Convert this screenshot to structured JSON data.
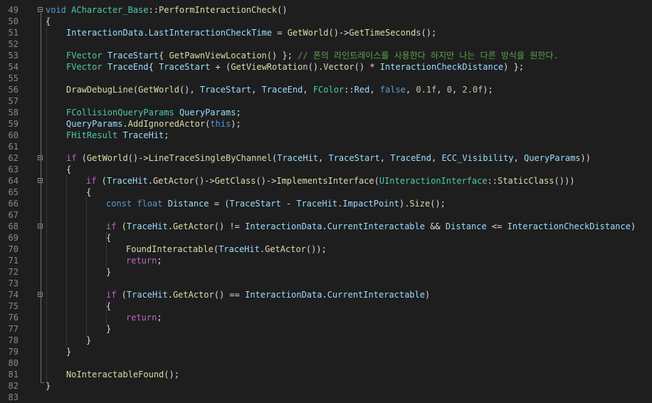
{
  "editor": {
    "lines": [
      {
        "num": "49",
        "fold": true,
        "indent": 0,
        "tokens": [
          {
            "t": "void",
            "c": "kw"
          },
          {
            "t": " ",
            "c": "pl"
          },
          {
            "t": "ACharacter_Base",
            "c": "ty"
          },
          {
            "t": "::",
            "c": "pl"
          },
          {
            "t": "PerformInteractionCheck",
            "c": "fn"
          },
          {
            "t": "()",
            "c": "pl"
          }
        ]
      },
      {
        "num": "50",
        "indent": 0,
        "tokens": [
          {
            "t": "{",
            "c": "pl"
          }
        ]
      },
      {
        "num": "51",
        "indent": 1,
        "tokens": [
          {
            "t": "InteractionData",
            "c": "var"
          },
          {
            "t": ".",
            "c": "pl"
          },
          {
            "t": "LastInteractionCheckTime",
            "c": "var"
          },
          {
            "t": " = ",
            "c": "pl"
          },
          {
            "t": "GetWorld",
            "c": "fn"
          },
          {
            "t": "()->",
            "c": "pl"
          },
          {
            "t": "GetTimeSeconds",
            "c": "fn"
          },
          {
            "t": "();",
            "c": "pl"
          }
        ]
      },
      {
        "num": "52",
        "indent": 1,
        "tokens": []
      },
      {
        "num": "53",
        "indent": 1,
        "tokens": [
          {
            "t": "FVector",
            "c": "ty"
          },
          {
            "t": " ",
            "c": "pl"
          },
          {
            "t": "TraceStart",
            "c": "var"
          },
          {
            "t": "{ ",
            "c": "pl"
          },
          {
            "t": "GetPawnViewLocation",
            "c": "fn"
          },
          {
            "t": "() }; ",
            "c": "pl"
          },
          {
            "t": "// 폰의 라인트레이스를 사용한다 하지만 나는 다른 방식을 원한다.",
            "c": "cm"
          }
        ]
      },
      {
        "num": "54",
        "indent": 1,
        "tokens": [
          {
            "t": "FVector",
            "c": "ty"
          },
          {
            "t": " ",
            "c": "pl"
          },
          {
            "t": "TraceEnd",
            "c": "var"
          },
          {
            "t": "{ ",
            "c": "pl"
          },
          {
            "t": "TraceStart",
            "c": "var"
          },
          {
            "t": " + (",
            "c": "pl"
          },
          {
            "t": "GetViewRotation",
            "c": "fn"
          },
          {
            "t": "().",
            "c": "pl"
          },
          {
            "t": "Vector",
            "c": "fn"
          },
          {
            "t": "() * ",
            "c": "pl"
          },
          {
            "t": "InteractionCheckDistance",
            "c": "var"
          },
          {
            "t": ") };",
            "c": "pl"
          }
        ]
      },
      {
        "num": "55",
        "indent": 1,
        "tokens": []
      },
      {
        "num": "56",
        "indent": 1,
        "tokens": [
          {
            "t": "DrawDebugLine",
            "c": "fn"
          },
          {
            "t": "(",
            "c": "pl"
          },
          {
            "t": "GetWorld",
            "c": "fn"
          },
          {
            "t": "(), ",
            "c": "pl"
          },
          {
            "t": "TraceStart",
            "c": "var"
          },
          {
            "t": ", ",
            "c": "pl"
          },
          {
            "t": "TraceEnd",
            "c": "var"
          },
          {
            "t": ", ",
            "c": "pl"
          },
          {
            "t": "FColor",
            "c": "ty"
          },
          {
            "t": "::",
            "c": "pl"
          },
          {
            "t": "Red",
            "c": "var"
          },
          {
            "t": ", ",
            "c": "pl"
          },
          {
            "t": "false",
            "c": "kw"
          },
          {
            "t": ", ",
            "c": "pl"
          },
          {
            "t": "0.1f",
            "c": "num"
          },
          {
            "t": ", ",
            "c": "pl"
          },
          {
            "t": "0",
            "c": "num"
          },
          {
            "t": ", ",
            "c": "pl"
          },
          {
            "t": "2.0f",
            "c": "num"
          },
          {
            "t": ");",
            "c": "pl"
          }
        ]
      },
      {
        "num": "57",
        "indent": 1,
        "tokens": []
      },
      {
        "num": "58",
        "indent": 1,
        "tokens": [
          {
            "t": "FCollisionQueryParams",
            "c": "ty"
          },
          {
            "t": " ",
            "c": "pl"
          },
          {
            "t": "QueryParams",
            "c": "var"
          },
          {
            "t": ";",
            "c": "pl"
          }
        ]
      },
      {
        "num": "59",
        "indent": 1,
        "tokens": [
          {
            "t": "QueryParams",
            "c": "var"
          },
          {
            "t": ".",
            "c": "pl"
          },
          {
            "t": "AddIgnoredActor",
            "c": "fn"
          },
          {
            "t": "(",
            "c": "pl"
          },
          {
            "t": "this",
            "c": "kw"
          },
          {
            "t": ");",
            "c": "pl"
          }
        ]
      },
      {
        "num": "60",
        "indent": 1,
        "tokens": [
          {
            "t": "FHitResult",
            "c": "ty"
          },
          {
            "t": " ",
            "c": "pl"
          },
          {
            "t": "TraceHit",
            "c": "var"
          },
          {
            "t": ";",
            "c": "pl"
          }
        ]
      },
      {
        "num": "61",
        "indent": 1,
        "tokens": []
      },
      {
        "num": "62",
        "fold": true,
        "indent": 1,
        "tokens": [
          {
            "t": "if",
            "c": "mac"
          },
          {
            "t": " (",
            "c": "pl"
          },
          {
            "t": "GetWorld",
            "c": "fn"
          },
          {
            "t": "()->",
            "c": "pl"
          },
          {
            "t": "LineTraceSingleByChannel",
            "c": "fn"
          },
          {
            "t": "(",
            "c": "pl"
          },
          {
            "t": "TraceHit",
            "c": "var"
          },
          {
            "t": ", ",
            "c": "pl"
          },
          {
            "t": "TraceStart",
            "c": "var"
          },
          {
            "t": ", ",
            "c": "pl"
          },
          {
            "t": "TraceEnd",
            "c": "var"
          },
          {
            "t": ", ",
            "c": "pl"
          },
          {
            "t": "ECC_Visibility",
            "c": "var"
          },
          {
            "t": ", ",
            "c": "pl"
          },
          {
            "t": "QueryParams",
            "c": "var"
          },
          {
            "t": "))",
            "c": "pl"
          }
        ]
      },
      {
        "num": "63",
        "indent": 1,
        "tokens": [
          {
            "t": "{",
            "c": "pl"
          }
        ]
      },
      {
        "num": "64",
        "fold": true,
        "indent": 2,
        "tokens": [
          {
            "t": "if",
            "c": "mac"
          },
          {
            "t": " (",
            "c": "pl"
          },
          {
            "t": "TraceHit",
            "c": "var"
          },
          {
            "t": ".",
            "c": "pl"
          },
          {
            "t": "GetActor",
            "c": "fn"
          },
          {
            "t": "()->",
            "c": "pl"
          },
          {
            "t": "GetClass",
            "c": "fn"
          },
          {
            "t": "()->",
            "c": "pl"
          },
          {
            "t": "ImplementsInterface",
            "c": "fn"
          },
          {
            "t": "(",
            "c": "pl"
          },
          {
            "t": "UInteractionInterface",
            "c": "ty"
          },
          {
            "t": "::",
            "c": "pl"
          },
          {
            "t": "StaticClass",
            "c": "fn"
          },
          {
            "t": "()))",
            "c": "pl"
          }
        ]
      },
      {
        "num": "65",
        "indent": 2,
        "tokens": [
          {
            "t": "{",
            "c": "pl"
          }
        ]
      },
      {
        "num": "66",
        "indent": 3,
        "tokens": [
          {
            "t": "const",
            "c": "kw"
          },
          {
            "t": " ",
            "c": "pl"
          },
          {
            "t": "float",
            "c": "kw"
          },
          {
            "t": " ",
            "c": "pl"
          },
          {
            "t": "Distance",
            "c": "var"
          },
          {
            "t": " = (",
            "c": "pl"
          },
          {
            "t": "TraceStart",
            "c": "var"
          },
          {
            "t": " - ",
            "c": "pl"
          },
          {
            "t": "TraceHit",
            "c": "var"
          },
          {
            "t": ".",
            "c": "pl"
          },
          {
            "t": "ImpactPoint",
            "c": "var"
          },
          {
            "t": ").",
            "c": "pl"
          },
          {
            "t": "Size",
            "c": "fn"
          },
          {
            "t": "();",
            "c": "pl"
          }
        ]
      },
      {
        "num": "67",
        "indent": 3,
        "tokens": []
      },
      {
        "num": "68",
        "fold": true,
        "indent": 3,
        "tokens": [
          {
            "t": "if",
            "c": "mac"
          },
          {
            "t": " (",
            "c": "pl"
          },
          {
            "t": "TraceHit",
            "c": "var"
          },
          {
            "t": ".",
            "c": "pl"
          },
          {
            "t": "GetActor",
            "c": "fn"
          },
          {
            "t": "() != ",
            "c": "pl"
          },
          {
            "t": "InteractionData",
            "c": "var"
          },
          {
            "t": ".",
            "c": "pl"
          },
          {
            "t": "CurrentInteractable",
            "c": "var"
          },
          {
            "t": " && ",
            "c": "pl"
          },
          {
            "t": "Distance",
            "c": "var"
          },
          {
            "t": " <= ",
            "c": "pl"
          },
          {
            "t": "InteractionCheckDistance",
            "c": "var"
          },
          {
            "t": ")",
            "c": "pl"
          }
        ]
      },
      {
        "num": "69",
        "indent": 3,
        "tokens": [
          {
            "t": "{",
            "c": "pl"
          }
        ]
      },
      {
        "num": "70",
        "indent": 4,
        "tokens": [
          {
            "t": "FoundInteractable",
            "c": "fn"
          },
          {
            "t": "(",
            "c": "pl"
          },
          {
            "t": "TraceHit",
            "c": "var"
          },
          {
            "t": ".",
            "c": "pl"
          },
          {
            "t": "GetActor",
            "c": "fn"
          },
          {
            "t": "());",
            "c": "pl"
          }
        ]
      },
      {
        "num": "71",
        "indent": 4,
        "tokens": [
          {
            "t": "return",
            "c": "mac"
          },
          {
            "t": ";",
            "c": "pl"
          }
        ]
      },
      {
        "num": "72",
        "indent": 3,
        "tokens": [
          {
            "t": "}",
            "c": "pl"
          }
        ]
      },
      {
        "num": "73",
        "indent": 3,
        "tokens": []
      },
      {
        "num": "74",
        "fold": true,
        "indent": 3,
        "tokens": [
          {
            "t": "if",
            "c": "mac"
          },
          {
            "t": " (",
            "c": "pl"
          },
          {
            "t": "TraceHit",
            "c": "var"
          },
          {
            "t": ".",
            "c": "pl"
          },
          {
            "t": "GetActor",
            "c": "fn"
          },
          {
            "t": "() == ",
            "c": "pl"
          },
          {
            "t": "InteractionData",
            "c": "var"
          },
          {
            "t": ".",
            "c": "pl"
          },
          {
            "t": "CurrentInteractable",
            "c": "var"
          },
          {
            "t": ")",
            "c": "pl"
          }
        ]
      },
      {
        "num": "75",
        "indent": 3,
        "tokens": [
          {
            "t": "{",
            "c": "pl"
          }
        ]
      },
      {
        "num": "76",
        "indent": 4,
        "tokens": [
          {
            "t": "return",
            "c": "mac"
          },
          {
            "t": ";",
            "c": "pl"
          }
        ]
      },
      {
        "num": "77",
        "indent": 3,
        "tokens": [
          {
            "t": "}",
            "c": "pl"
          }
        ]
      },
      {
        "num": "78",
        "indent": 2,
        "tokens": [
          {
            "t": "}",
            "c": "pl"
          }
        ]
      },
      {
        "num": "79",
        "indent": 1,
        "tokens": [
          {
            "t": "}",
            "c": "pl"
          }
        ]
      },
      {
        "num": "80",
        "indent": 1,
        "tokens": []
      },
      {
        "num": "81",
        "indent": 1,
        "tokens": [
          {
            "t": "NoInteractableFound",
            "c": "fn"
          },
          {
            "t": "();",
            "c": "pl"
          }
        ]
      },
      {
        "num": "82",
        "indent": 0,
        "tokens": [
          {
            "t": "}",
            "c": "pl"
          }
        ]
      },
      {
        "num": "83",
        "indent": 0,
        "tokens": []
      }
    ]
  }
}
